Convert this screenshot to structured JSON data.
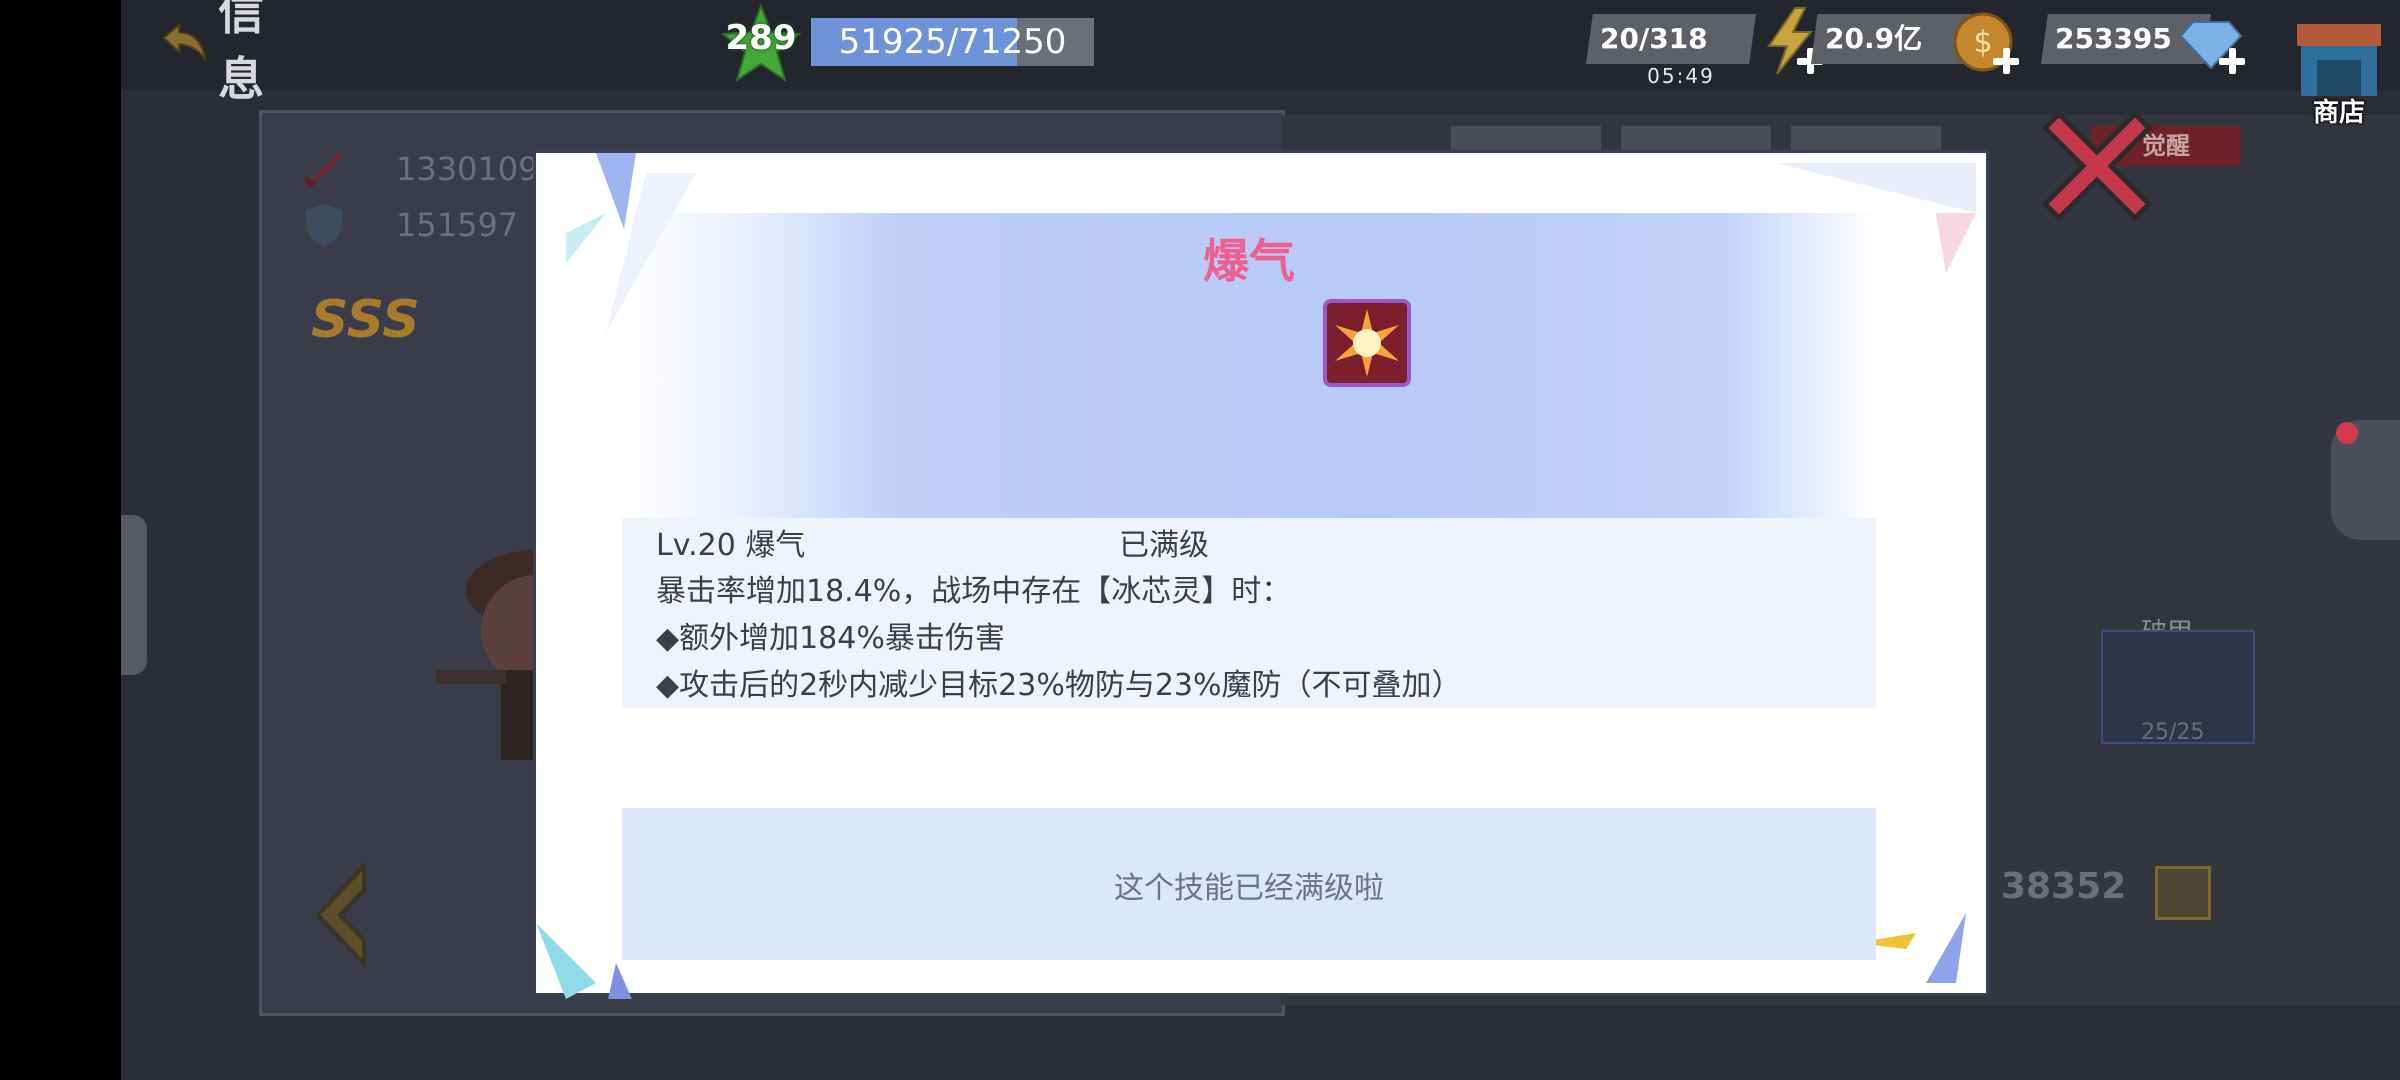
{
  "header": {
    "back_label": "信息",
    "level": "289",
    "exp": {
      "text": "51925/71250",
      "current": 51925,
      "max": 71250
    }
  },
  "resources": {
    "stamina": {
      "value": "20/318",
      "timer": "05:49"
    },
    "gold": {
      "value": "20.9亿"
    },
    "diamond": {
      "value": "253395"
    },
    "shop_label": "商店"
  },
  "background": {
    "attack": "1330109",
    "defense": "151597",
    "rank": "SSS",
    "tab_awaken": "觉醒",
    "break_title": "破甲",
    "break_count": "25/25",
    "power_value": "38352"
  },
  "dialog": {
    "skill_name": "爆气",
    "level_line": "Lv.20 爆气",
    "status": "已满级",
    "desc_lines": [
      "暴击率增加18.4%，战场中存在【冰芯灵】时：",
      "◆额外增加184%暴击伤害",
      "◆攻击后的2秒内减少目标23%物防与23%魔防（不可叠加）"
    ],
    "note": "这个技能已经满级啦"
  },
  "colors": {
    "skill_title": "#ee5f8e",
    "exp_fill": "#6f93d8",
    "dialog_header": "#b7c9f7",
    "note_bg": "#dce7fb"
  },
  "icons": {
    "back": "back-arrow-icon",
    "level": "star-icon",
    "stamina": "lightning-icon",
    "gold": "gold-coin-icon",
    "diamond": "diamond-icon",
    "shop": "shop-icon",
    "close": "close-icon",
    "skill": "burst-skill-icon"
  }
}
